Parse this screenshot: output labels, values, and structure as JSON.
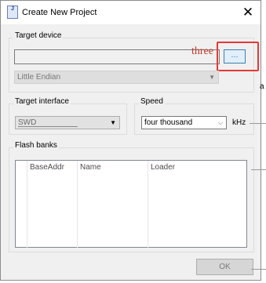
{
  "window": {
    "title": "Create New Project",
    "icon_text": "J",
    "icon_name": "app-icon",
    "close_glyph": "✕"
  },
  "target_device": {
    "group_label": "Target device",
    "device_value": "",
    "browse_label": "...",
    "endian_value": "Little Endian",
    "annotation": "three",
    "highlight_color": "#e53935"
  },
  "target_interface": {
    "group_label": "Target interface",
    "value": "SWD"
  },
  "speed": {
    "group_label": "Speed",
    "value": "four thousand",
    "unit": "kHz"
  },
  "flash_banks": {
    "group_label": "Flash banks",
    "columns": [
      "BaseAddr",
      "Name",
      "Loader"
    ]
  },
  "footer": {
    "ok_label": "OK"
  },
  "background_edge_char": "a"
}
